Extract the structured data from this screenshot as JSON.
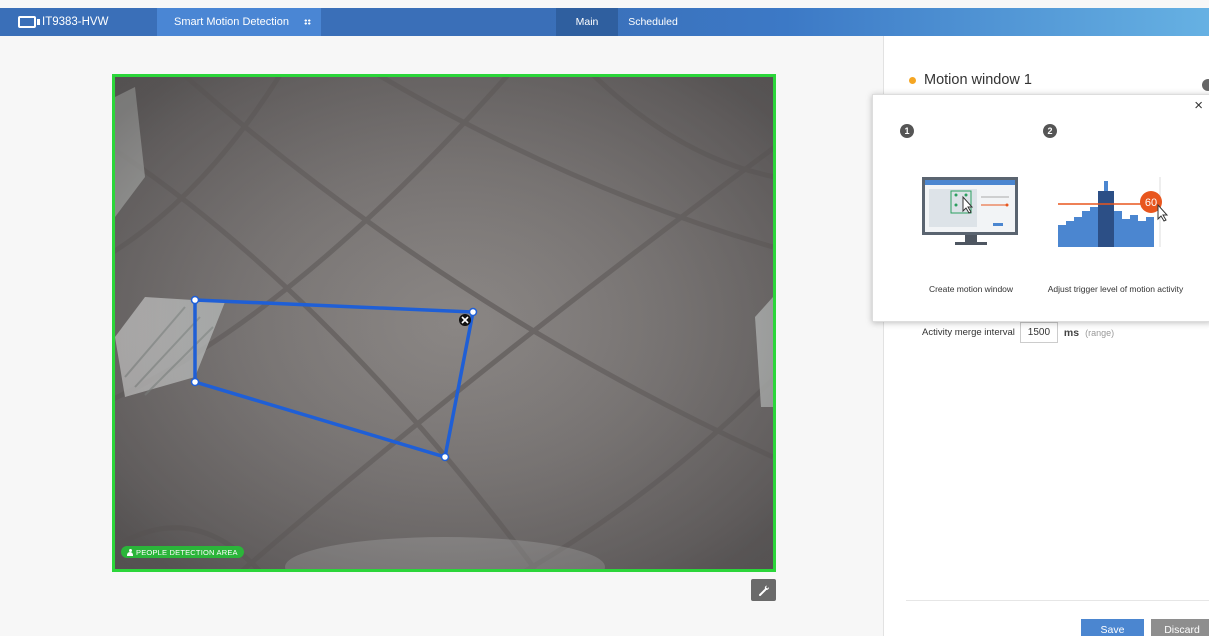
{
  "topbar": {
    "brand": "IT9383-HVW",
    "app_tab": "Smart Motion Detection",
    "tabs": [
      "Main",
      "Scheduled"
    ]
  },
  "video": {
    "badge": "PEOPLE DETECTION AREA"
  },
  "panel": {
    "window_title": "Motion window 1",
    "merge_label": "Activity merge interval",
    "merge_value": "1500",
    "merge_unit": "ms",
    "merge_range": "(range)",
    "save_label": "Save",
    "discard_label": "Discard"
  },
  "popover": {
    "close": "×",
    "steps": [
      {
        "num": "1",
        "caption": "Create motion window"
      },
      {
        "num": "2",
        "caption": "Adjust trigger level of motion activity"
      }
    ],
    "level_value": "60"
  },
  "colors": {
    "topbar": "#3a6fb8",
    "active_tab": "#2f5f9f",
    "area_border": "#2bd63a",
    "polygon": "#1f5fd6",
    "accent_orange": "#e8561e",
    "window_dot": "#f5a623"
  }
}
